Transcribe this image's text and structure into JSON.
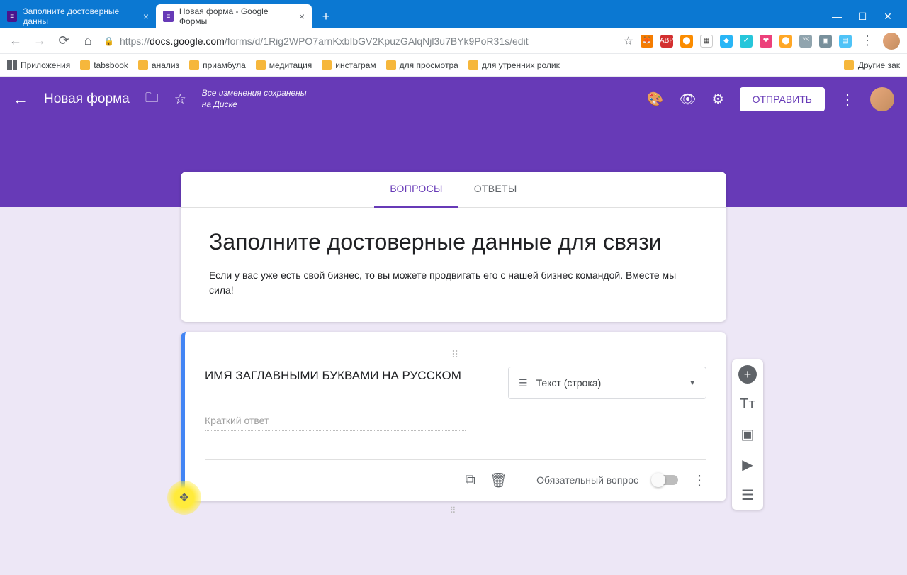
{
  "browser": {
    "tabs": [
      {
        "title": "Заполните достоверные данны",
        "active": false
      },
      {
        "title": "Новая форма - Google Формы",
        "active": true
      }
    ],
    "url_prefix": "https://",
    "url_host": "docs.google.com",
    "url_path": "/forms/d/1Rig2WPO7arnKxbIbGV2KpuzGAlqNjl3u7BYk9PoR31s/edit"
  },
  "bookmarks": {
    "apps": "Приложения",
    "items": [
      "tabsbook",
      "анализ",
      "приамбула",
      "медитация",
      "инстаграм",
      "для просмотра",
      "для утренних ролик"
    ],
    "other": "Другие зак"
  },
  "header": {
    "form_name": "Новая форма",
    "save_line1": "Все изменения сохранены",
    "save_line2": "на Диске",
    "send": "ОТПРАВИТЬ"
  },
  "tabs": {
    "questions": "ВОПРОСЫ",
    "responses": "ОТВЕТЫ"
  },
  "form": {
    "title": "Заполните достоверные данные для связи",
    "description": "Если у вас уже есть свой бизнес, то вы можете продвигать его с нашей бизнес командой. Вместе мы сила!"
  },
  "question": {
    "title": "ИМЯ ЗАГЛАВНЫМИ БУКВАМИ НА РУССКОМ",
    "type_label": "Текст (строка)",
    "answer_placeholder": "Краткий ответ",
    "required_label": "Обязательный вопрос"
  }
}
